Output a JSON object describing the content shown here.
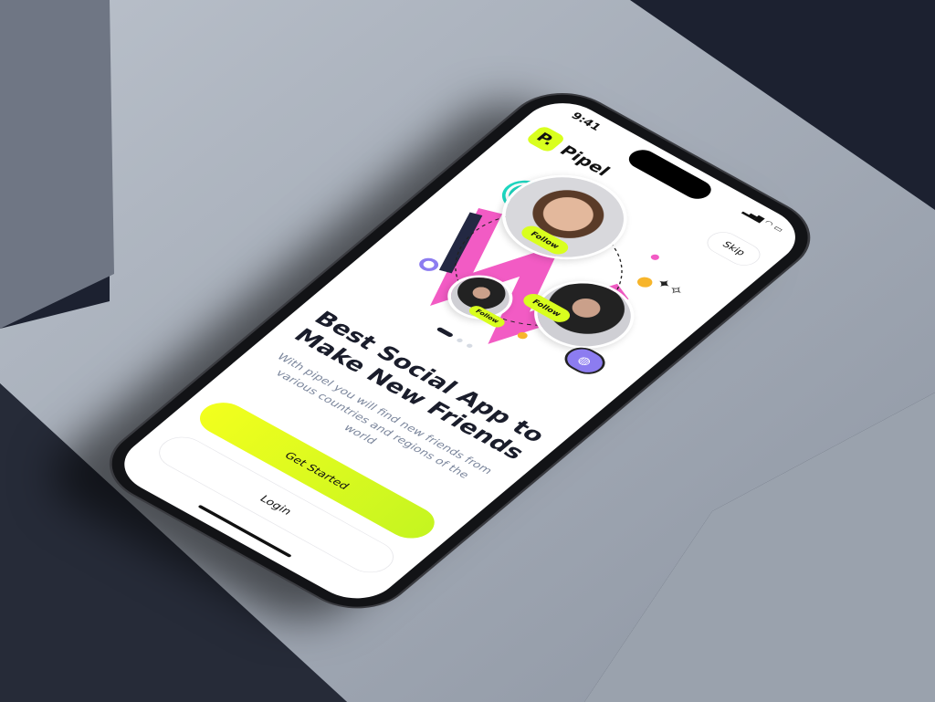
{
  "status_bar": {
    "time": "9:41",
    "signal": "▂▄▆ ◠ ▭"
  },
  "brand": {
    "badge": "P.",
    "name": "Pipel",
    "accent": "#d9ff1e"
  },
  "header": {
    "skip_label": "Skip"
  },
  "illustration": {
    "follow_labels": [
      "Follow",
      "Follow",
      "Follow"
    ],
    "pink": "#f25bc4",
    "globe_icon": "globe-icon"
  },
  "carousel": {
    "active_index": 0,
    "count": 3
  },
  "onboarding": {
    "title": "Best Social App to Make New Friends",
    "subtitle": "With pipel you will find new friends from various countries and regions of the world"
  },
  "actions": {
    "get_started": "Get Started",
    "login": "Login"
  }
}
